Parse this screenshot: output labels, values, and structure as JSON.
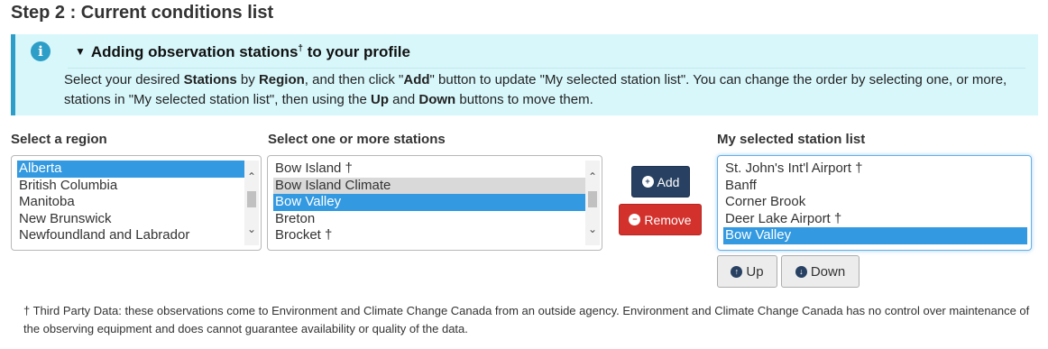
{
  "page": {
    "step_title": "Step 2 : Current conditions list"
  },
  "info": {
    "icon": "info-icon",
    "icon_glyph": "i",
    "toggle_glyph": "▼",
    "title": "Adding observation stations",
    "title_sup": "†",
    "title_suffix": " to your profile",
    "body_parts": [
      "Select your desired ",
      "Stations",
      " by ",
      "Region",
      ", and then click \"",
      "Add",
      "\" button to update \"My selected station list\". You can change the order by selecting one, or more, stations in \"My selected station list\", then using the ",
      "Up",
      " and ",
      "Down",
      " buttons to move them."
    ]
  },
  "region": {
    "label": "Select a region",
    "options": [
      "Alberta",
      "British Columbia",
      "Manitoba",
      "New Brunswick",
      "Newfoundland and Labrador"
    ],
    "selected": "Alberta"
  },
  "stations": {
    "label": "Select one or more stations",
    "options": [
      "Bow Island †",
      "Bow Island Climate",
      "Bow Valley",
      "Breton",
      "Brocket †"
    ],
    "selected": "Bow Valley",
    "hovered": "Bow Island Climate"
  },
  "actions": {
    "add_label": "Add",
    "remove_label": "Remove",
    "add_icon": "plus-circle-icon",
    "remove_icon": "minus-circle-icon"
  },
  "my_list": {
    "label": "My selected station list",
    "options": [
      "St. John's Int'l Airport †",
      "Banff",
      "Corner Brook",
      "Deer Lake Airport †",
      "Bow Valley"
    ],
    "selected": "Bow Valley",
    "up_label": "Up",
    "down_label": "Down",
    "up_icon": "arrow-up-circle-icon",
    "down_icon": "arrow-down-circle-icon"
  },
  "footnote": "† Third Party Data: these observations come to Environment and Climate Change Canada from an outside agency. Environment and Climate Change Canada has no control over maintenance of the observing equipment and does cannot guarantee availability or quality of the data.",
  "colors": {
    "info_bg": "#d7f7fb",
    "info_accent": "#2d9ec8",
    "add_btn": "#284162",
    "remove_btn": "#d3312c",
    "selected_option": "#3399e0"
  }
}
